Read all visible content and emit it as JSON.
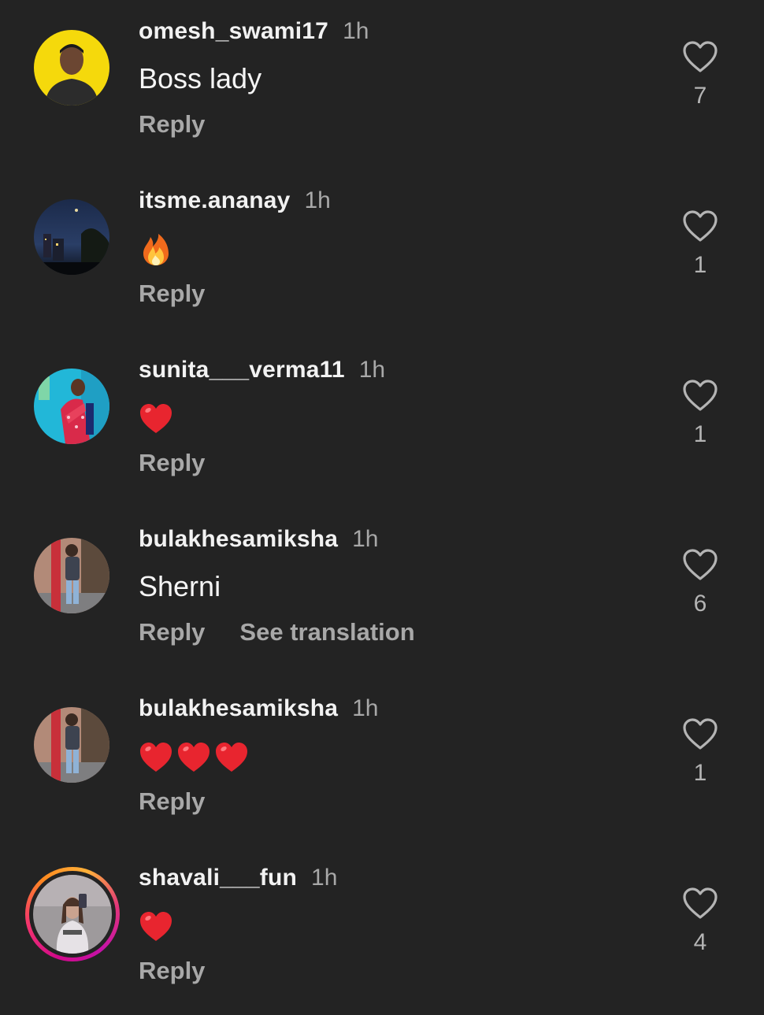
{
  "comments": [
    {
      "username": "omesh_swami17",
      "time": "1h",
      "text": "Boss lady",
      "reply_label": "Reply",
      "likes": "7",
      "avatar": "man-on-yellow-background"
    },
    {
      "username": "itsme.ananay",
      "time": "1h",
      "emoji": [
        "fire-emoji"
      ],
      "reply_label": "Reply",
      "likes": "1",
      "avatar": "night-city-skyline"
    },
    {
      "username": "sunita___verma11",
      "time": "1h",
      "emoji": [
        "red-heart-emoji"
      ],
      "reply_label": "Reply",
      "likes": "1",
      "avatar": "woman-in-red-saree"
    },
    {
      "username": "bulakhesamiksha",
      "time": "1h",
      "text": "Sherni",
      "reply_label": "Reply",
      "translate_label": "See translation",
      "likes": "6",
      "avatar": "child-outdoors"
    },
    {
      "username": "bulakhesamiksha",
      "time": "1h",
      "emoji": [
        "red-heart-emoji",
        "red-heart-emoji",
        "red-heart-emoji"
      ],
      "reply_label": "Reply",
      "likes": "1",
      "avatar": "child-outdoors"
    },
    {
      "username": "shavali___fun",
      "time": "1h",
      "emoji": [
        "red-heart-emoji"
      ],
      "reply_label": "Reply",
      "likes": "4",
      "avatar": "mirror-selfie",
      "has_story_ring": true
    }
  ],
  "colors": {
    "background": "#232323",
    "text_primary": "#f2f2f2",
    "text_secondary": "#a8a8a8",
    "heart_emoji": "#e8252f",
    "story_ring": "#d10a8a"
  }
}
